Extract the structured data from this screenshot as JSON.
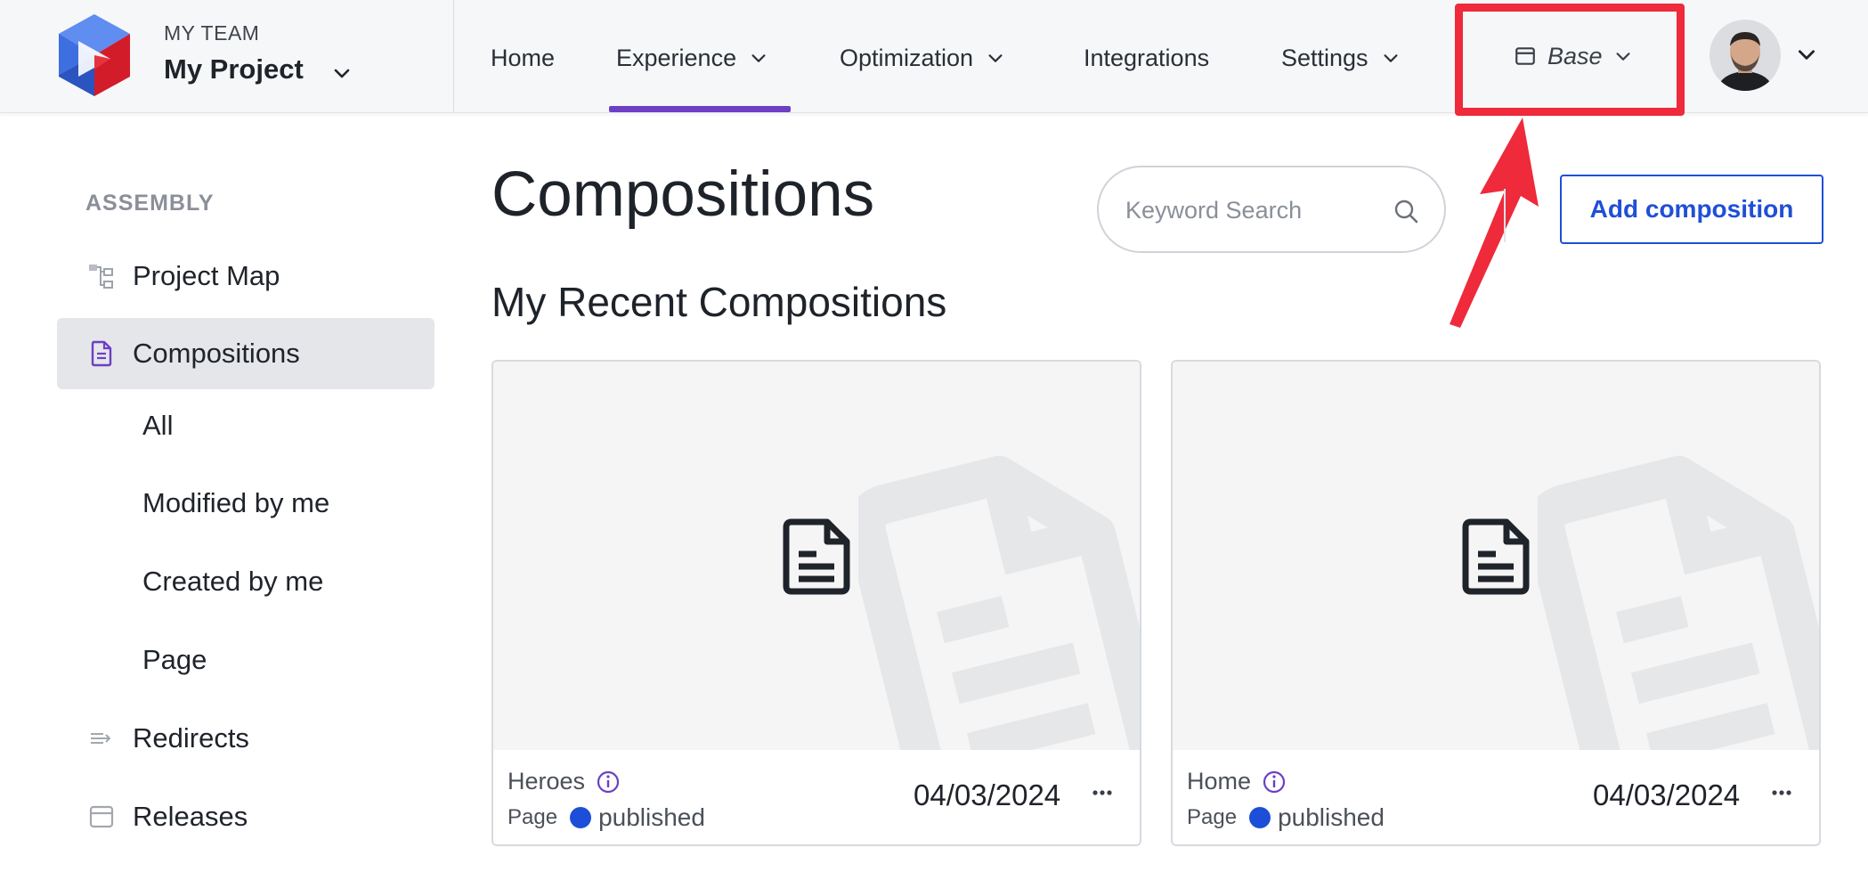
{
  "header": {
    "team_name": "MY TEAM",
    "project_name": "My Project",
    "nav": [
      {
        "label": "Home",
        "has_dropdown": false,
        "active": false
      },
      {
        "label": "Experience",
        "has_dropdown": true,
        "active": true
      },
      {
        "label": "Optimization",
        "has_dropdown": true,
        "active": false
      },
      {
        "label": "Integrations",
        "has_dropdown": false,
        "active": false
      },
      {
        "label": "Settings",
        "has_dropdown": true,
        "active": false
      }
    ],
    "base_label": "Base",
    "accent_color": "#6c3fc4",
    "highlight_color": "#ee2a3b"
  },
  "sidebar": {
    "heading": "ASSEMBLY",
    "items": [
      {
        "label": "Project Map",
        "icon": "project-map-icon"
      },
      {
        "label": "Compositions",
        "icon": "compositions-icon",
        "active": true
      },
      {
        "label": "Redirects",
        "icon": "redirects-icon"
      },
      {
        "label": "Releases",
        "icon": "releases-icon"
      }
    ],
    "sub_items": [
      "All",
      "Modified by me",
      "Created by me",
      "Page"
    ]
  },
  "main": {
    "title": "Compositions",
    "search_placeholder": "Keyword Search",
    "add_button": "Add composition",
    "section_title": "My Recent Compositions",
    "cards": [
      {
        "name": "Heroes",
        "type": "Page",
        "status": "published",
        "date": "04/03/2024"
      },
      {
        "name": "Home",
        "type": "Page",
        "status": "published",
        "date": "04/03/2024"
      }
    ],
    "status_color": "#1d4ed8",
    "button_color": "#1f4fd8"
  }
}
